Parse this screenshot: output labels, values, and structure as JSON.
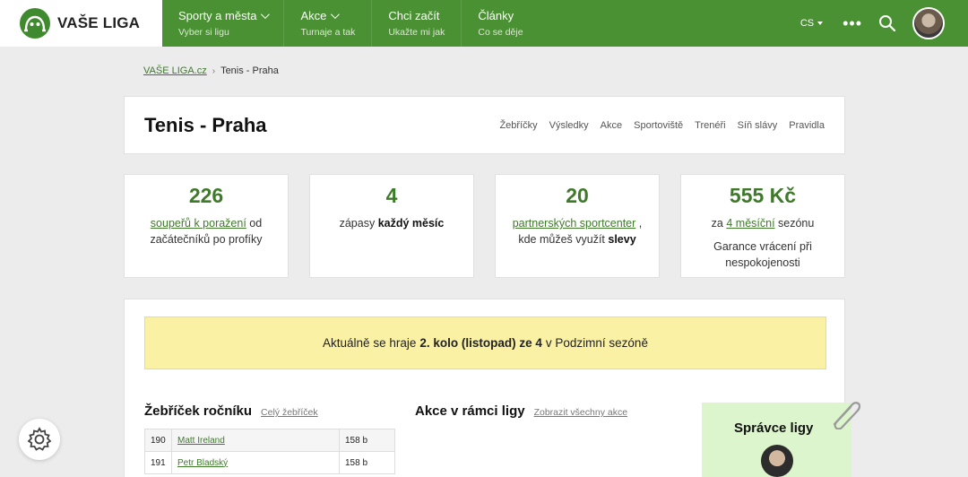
{
  "brand": {
    "name": "VAŠE LIGA"
  },
  "nav": [
    {
      "title": "Sporty a města",
      "sub": "Vyber si ligu",
      "has_chevron": true
    },
    {
      "title": "Akce",
      "sub": "Turnaje a tak",
      "has_chevron": true
    },
    {
      "title": "Chci začít",
      "sub": "Ukažte mi jak",
      "has_chevron": false
    },
    {
      "title": "Články",
      "sub": "Co se děje",
      "has_chevron": false
    }
  ],
  "header": {
    "lang": "CS",
    "more": "•••"
  },
  "breadcrumb": {
    "home": "VAŠE LIGA.cz",
    "current": "Tenis - Praha"
  },
  "page": {
    "title": "Tenis - Praha",
    "subnav": [
      "Žebříčky",
      "Výsledky",
      "Akce",
      "Sportoviště",
      "Trenéři",
      "Síň slávy",
      "Pravidla"
    ]
  },
  "stats": [
    {
      "num": "226",
      "link": "soupeřů k poražení",
      "after_link": " od",
      "line2": "začátečníků po profíky"
    },
    {
      "num": "4",
      "pre": "zápasy ",
      "bold": "každý měsíc"
    },
    {
      "num": "20",
      "link": "partnerských sportcenter",
      "after_link": " ,",
      "line2_pre": "kde můžeš využít ",
      "line2_bold": "slevy"
    },
    {
      "num": "555 Kč",
      "pre": "za ",
      "link": "4 měsíční",
      "after_link": " sezónu",
      "line2": "Garance vrácení při",
      "line3": "nespokojenosti"
    }
  ],
  "notice": {
    "pre": "Aktuálně se hraje",
    "bold": "2. kolo (listopad) ze 4",
    "post": "v Podzimní sezóně"
  },
  "ranking": {
    "title": "Žebříček ročníku",
    "link": "Celý žebříček",
    "rows": [
      {
        "rank": "190",
        "name": "Matt Ireland",
        "points": "158 b"
      },
      {
        "rank": "191",
        "name": "Petr Bladský",
        "points": "158 b"
      }
    ]
  },
  "events": {
    "title": "Akce v rámci ligy",
    "link": "Zobrazit všechny akce"
  },
  "manager": {
    "title": "Správce ligy"
  },
  "colors": {
    "brand_green": "#4a9133",
    "accent_green": "#3f7a2b",
    "notice_yellow": "#faf1a4",
    "manager_bg": "#dcf5cc"
  }
}
